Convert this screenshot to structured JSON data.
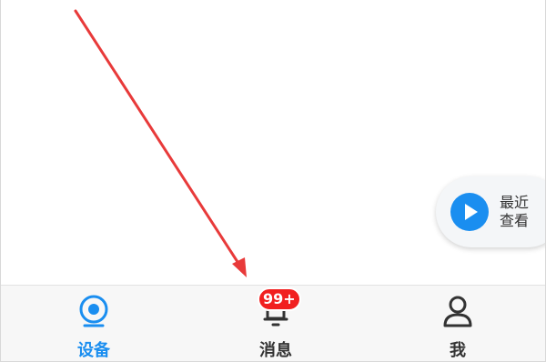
{
  "colors": {
    "accent": "#1a8ef0",
    "badge": "#f12020",
    "annotation_arrow": "#e83a3a",
    "tab_inactive": "#333333"
  },
  "floating": {
    "recent_label": "最近查看",
    "play_icon": "play-icon"
  },
  "tabbar": {
    "tabs": [
      {
        "label": "设备",
        "icon": "camera-icon",
        "active": true
      },
      {
        "label": "消息",
        "icon": "bell-icon",
        "active": false,
        "badge": "99+"
      },
      {
        "label": "我",
        "icon": "person-icon",
        "active": false
      }
    ]
  }
}
